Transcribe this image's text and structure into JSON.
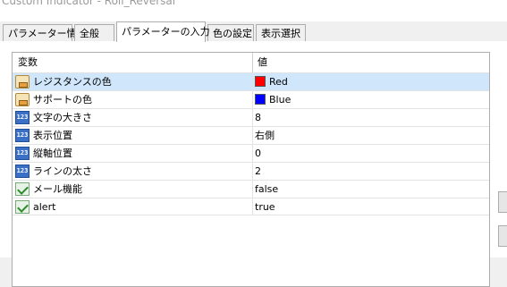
{
  "window": {
    "title": "Custom Indicator - Roll_Reversal"
  },
  "tabs": [
    {
      "label": "パラメーター情報"
    },
    {
      "label": "全般"
    },
    {
      "label": "パラメーターの入力"
    },
    {
      "label": "色の設定"
    },
    {
      "label": "表示選択"
    }
  ],
  "table": {
    "headers": {
      "variable": "変数",
      "value": "値"
    },
    "rows": [
      {
        "name": "レジスタンスの色",
        "value": "Red",
        "type_icon": "color-icon",
        "swatch": "#ff0000",
        "selected": true
      },
      {
        "name": "サポートの色",
        "value": "Blue",
        "type_icon": "color-icon",
        "swatch": "#0000ff"
      },
      {
        "name": "文字の大きさ",
        "value": "8",
        "type_icon": "integer-icon"
      },
      {
        "name": "表示位置",
        "value": "右側",
        "type_icon": "integer-icon"
      },
      {
        "name": "縦軸位置",
        "value": "0",
        "type_icon": "integer-icon"
      },
      {
        "name": "ラインの太さ",
        "value": "2",
        "type_icon": "integer-icon"
      },
      {
        "name": "メール機能",
        "value": "false",
        "type_icon": "boolean-icon"
      },
      {
        "name": "alert",
        "value": "true",
        "type_icon": "boolean-icon"
      }
    ]
  }
}
